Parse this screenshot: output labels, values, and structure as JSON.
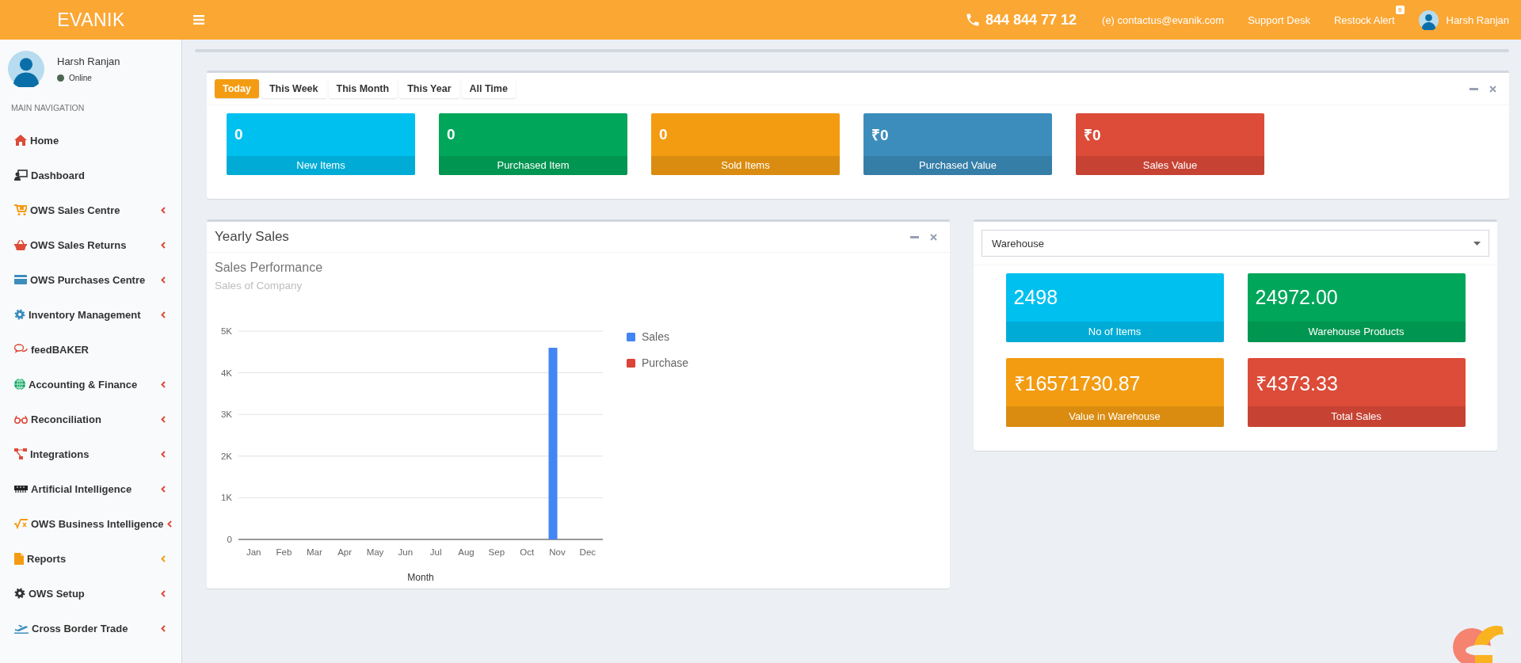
{
  "header": {
    "logo": "EVANIK",
    "phone": "844 844 77 12",
    "email": "(e) contactus@evanik.com",
    "links": [
      "Support Desk"
    ],
    "restock": {
      "label": "Restock Alert",
      "badge": "0"
    },
    "user": "Harsh Ranjan"
  },
  "sidebar": {
    "user": {
      "name": "Harsh Ranjan",
      "status": "Online"
    },
    "heading": "MAIN NAVIGATION",
    "items": [
      {
        "label": "Home",
        "has_submenu": false
      },
      {
        "label": "Dashboard",
        "has_submenu": false
      },
      {
        "label": "OWS Sales Centre",
        "has_submenu": true
      },
      {
        "label": "OWS Sales Returns",
        "has_submenu": true
      },
      {
        "label": "OWS Purchases Centre",
        "has_submenu": true
      },
      {
        "label": "Inventory Management",
        "has_submenu": true
      },
      {
        "label": "feedBAKER",
        "has_submenu": false
      },
      {
        "label": "Accounting & Finance",
        "has_submenu": true
      },
      {
        "label": "Reconciliation",
        "has_submenu": true
      },
      {
        "label": "Integrations",
        "has_submenu": true
      },
      {
        "label": "Artificial Intelligence",
        "has_submenu": true
      },
      {
        "label": "OWS Business Intelligence",
        "has_submenu": true
      },
      {
        "label": "Reports",
        "has_submenu": true
      },
      {
        "label": "OWS Setup",
        "has_submenu": true
      },
      {
        "label": "Cross Border Trade",
        "has_submenu": true
      }
    ]
  },
  "summary": {
    "tabs": [
      {
        "label": "Today",
        "selected": true
      },
      {
        "label": "This Week",
        "selected": false
      },
      {
        "label": "This Month",
        "selected": false
      },
      {
        "label": "This Year",
        "selected": false
      },
      {
        "label": "All Time",
        "selected": false
      }
    ],
    "stats": [
      {
        "value": "0",
        "label": "New Items",
        "color": "#00c0ef"
      },
      {
        "value": "0",
        "label": "Purchased Item",
        "color": "#00a65a"
      },
      {
        "value": "0",
        "label": "Sold Items",
        "color": "#f39c12"
      },
      {
        "value": "₹0",
        "label": "Purchased Value",
        "color": "#3c8dbc"
      },
      {
        "value": "₹0",
        "label": "Sales Value",
        "color": "#dd4b39"
      }
    ]
  },
  "yearly_sales": {
    "title": "Yearly Sales",
    "chart_title": "Sales Performance",
    "chart_subtitle": "Sales of Company",
    "chart_data": {
      "type": "bar",
      "xlabel": "Month",
      "categories": [
        "Jan",
        "Feb",
        "Mar",
        "Apr",
        "May",
        "Jun",
        "Jul",
        "Aug",
        "Sep",
        "Oct",
        "Nov",
        "Dec"
      ],
      "series": [
        {
          "name": "Sales",
          "color": "#4285f4",
          "values": [
            0,
            0,
            0,
            0,
            0,
            0,
            0,
            0,
            0,
            0,
            4600,
            0
          ]
        },
        {
          "name": "Purchase",
          "color": "#db4437",
          "values": [
            0,
            0,
            0,
            0,
            0,
            0,
            0,
            0,
            0,
            0,
            0,
            0
          ]
        }
      ],
      "ylim": [
        0,
        5000
      ],
      "grid": true,
      "yticks": [
        {
          "value": 0,
          "label": "0"
        },
        {
          "value": 1000,
          "label": "1K"
        },
        {
          "value": 2000,
          "label": "2K"
        },
        {
          "value": 3000,
          "label": "3K"
        },
        {
          "value": 4000,
          "label": "4K"
        },
        {
          "value": 5000,
          "label": "5K"
        }
      ]
    }
  },
  "warehouse": {
    "select": "Warehouse",
    "stats": [
      {
        "value": "2498",
        "label": "No of Items",
        "color": "#00c0ef"
      },
      {
        "value": "24972.00",
        "label": "Warehouse Products",
        "color": "#00a65a"
      },
      {
        "value": "₹16571730.87",
        "label": "Value in Warehouse",
        "color": "#f39c12"
      },
      {
        "value": "₹4373.33",
        "label": "Total Sales",
        "color": "#dd4b39"
      }
    ]
  }
}
